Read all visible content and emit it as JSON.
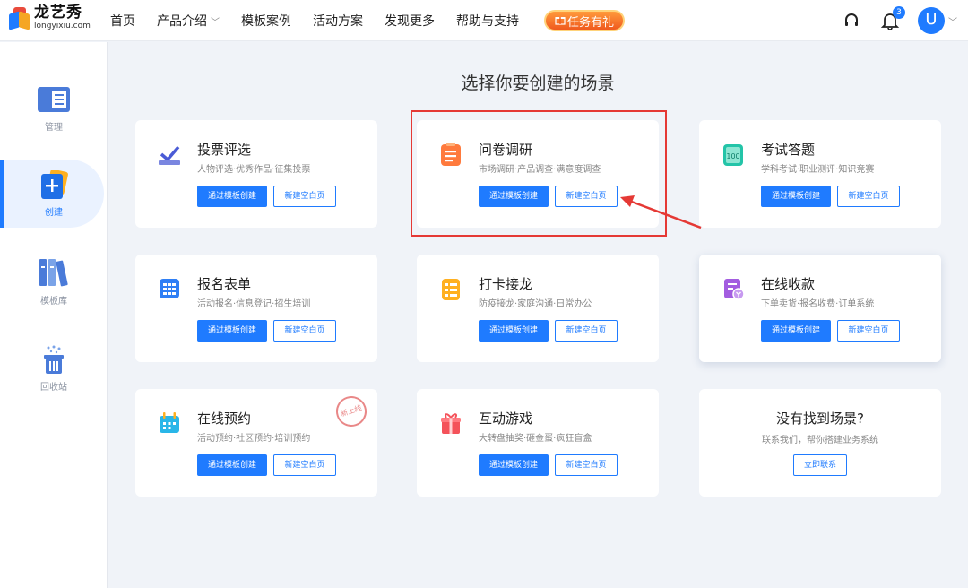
{
  "logo": {
    "cn": "龙艺秀",
    "en": "longyixiu.com"
  },
  "nav": {
    "items": [
      "首页",
      "产品介绍",
      "模板案例",
      "活动方案",
      "发现更多",
      "帮助与支持"
    ],
    "dropdown_chevron": "﹀",
    "task_button": "任务有礼"
  },
  "header_right": {
    "notification_count": "3",
    "avatar_letter": "U"
  },
  "sidebar": {
    "items": [
      {
        "label": "管理",
        "icon": "manage-icon"
      },
      {
        "label": "创建",
        "icon": "create-icon"
      },
      {
        "label": "模板库",
        "icon": "template-library-icon"
      },
      {
        "label": "回收站",
        "icon": "recycle-bin-icon"
      }
    ]
  },
  "heading": "选择你要创建的场景",
  "buttons": {
    "from_template": "通过模板创建",
    "blank_page": "新建空白页"
  },
  "cards": [
    {
      "title": "投票评选",
      "sub": "人物评选·优秀作品·征集投票",
      "icon": "vote-icon"
    },
    {
      "title": "问卷调研",
      "sub": "市场调研·产品调查·满意度调查",
      "icon": "survey-icon"
    },
    {
      "title": "考试答题",
      "sub": "学科考试·职业测评·知识竞赛",
      "icon": "exam-icon"
    },
    {
      "title": "报名表单",
      "sub": "活动报名·信息登记·招生培训",
      "icon": "form-icon"
    },
    {
      "title": "打卡接龙",
      "sub": "防疫接龙·家庭沟通·日常办公",
      "icon": "checkin-icon"
    },
    {
      "title": "在线收款",
      "sub": "下单卖货·报名收费·订单系统",
      "icon": "payment-icon"
    },
    {
      "title": "在线预约",
      "sub": "活动预约·社区预约·培训预约",
      "icon": "booking-icon",
      "stamp": "新上线"
    },
    {
      "title": "互动游戏",
      "sub": "大转盘抽奖·砸金蛋·疯狂盲盒",
      "icon": "game-icon"
    }
  ],
  "not_found": {
    "title": "没有找到场景?",
    "sub": "联系我们，帮你搭建业务系统",
    "button": "立即联系"
  },
  "colors": {
    "primary": "#1f7bff",
    "highlight": "#e53935",
    "background": "#f0f3f8"
  }
}
